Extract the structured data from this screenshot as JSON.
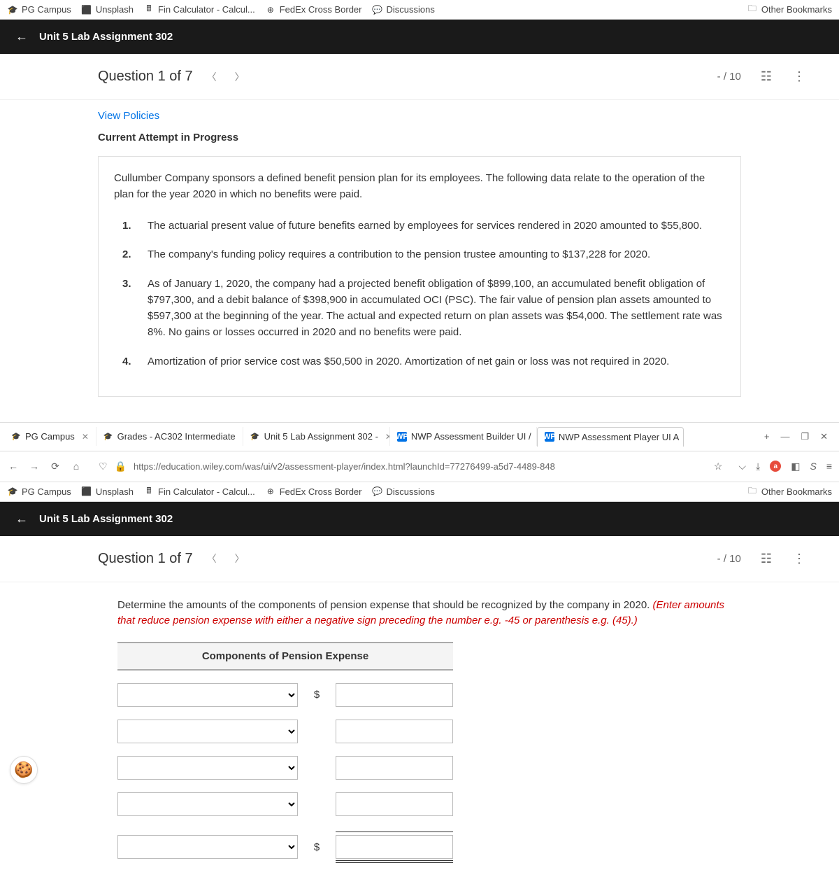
{
  "bookmarks": {
    "items": [
      {
        "icon": "🎓",
        "label": "PG Campus"
      },
      {
        "icon": "⬛",
        "label": "Unsplash"
      },
      {
        "icon": "🖩",
        "label": "Fin Calculator - Calcul..."
      },
      {
        "icon": "⊕",
        "label": "FedEx Cross Border"
      },
      {
        "icon": "💬",
        "label": "Discussions"
      }
    ],
    "other": "Other Bookmarks"
  },
  "assignment_title": "Unit 5 Lab Assignment 302",
  "question": {
    "label": "Question 1 of 7",
    "score": "- / 10"
  },
  "policies": "View Policies",
  "status": "Current Attempt in Progress",
  "intro": "Cullumber Company sponsors a defined benefit pension plan for its employees. The following data relate to the operation of the plan for the year 2020 in which no benefits were paid.",
  "items": [
    {
      "n": "1.",
      "t": "The actuarial present value of future benefits earned by employees for services rendered in 2020 amounted to $55,800."
    },
    {
      "n": "2.",
      "t": "The company's funding policy requires a contribution to the pension trustee amounting to $137,228 for 2020."
    },
    {
      "n": "3.",
      "t": "As of January 1, 2020, the company had a projected benefit obligation of $899,100, an accumulated benefit obligation of $797,300, and a debit balance of $398,900 in accumulated OCI (PSC). The fair value of pension plan assets amounted to $597,300 at the beginning of the year. The actual and expected return on plan assets was $54,000. The settlement rate was 8%. No gains or losses occurred in 2020 and no benefits were paid."
    },
    {
      "n": "4.",
      "t": "Amortization of prior service cost was $50,500 in 2020. Amortization of net gain or loss was not required in 2020."
    }
  ],
  "tabs": [
    {
      "icon": "🎓",
      "label": "PG Campus"
    },
    {
      "icon": "🎓",
      "label": "Grades - AC302 Intermediate"
    },
    {
      "icon": "🎓",
      "label": "Unit 5 Lab Assignment 302 -"
    },
    {
      "icon": "WP",
      "label": "NWP Assessment Builder UI /"
    },
    {
      "icon": "WP",
      "label": "NWP Assessment Player UI A"
    }
  ],
  "url": "https://education.wiley.com/was/ui/v2/assessment-player/index.html?launchId=77276499-a5d7-4489-848",
  "part2": {
    "instr": "Determine the amounts of the components of pension expense that should be recognized by the company in 2020. ",
    "note": "(Enter amounts that reduce pension expense with either a negative sign preceding the number e.g. -45 or parenthesis e.g. (45).)",
    "table_header": "Components of Pension Expense"
  }
}
